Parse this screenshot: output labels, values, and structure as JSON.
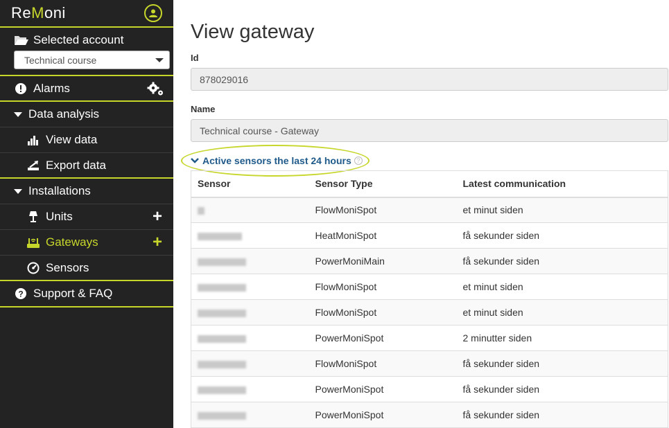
{
  "brand": {
    "logo_pre": "Re",
    "logo_m": "M",
    "logo_post": "oni",
    "accent": "#c7d62b"
  },
  "account": {
    "label": "Selected account",
    "selected": "Technical course"
  },
  "nav": {
    "alarms": "Alarms",
    "data_analysis": "Data analysis",
    "view_data": "View data",
    "export_data": "Export data",
    "installations": "Installations",
    "units": "Units",
    "gateways": "Gateways",
    "sensors": "Sensors",
    "support": "Support & FAQ",
    "plus": "+"
  },
  "main": {
    "title": "View gateway",
    "id_label": "Id",
    "id_value": "878029016",
    "name_label": "Name",
    "name_value": "Technical course - Gateway",
    "sensors_link": "Active sensors the last 24 hours",
    "help": "?"
  },
  "table": {
    "headers": [
      "Sensor",
      "Sensor Type",
      "Latest communication"
    ],
    "rows": [
      {
        "type": "FlowMoniSpot",
        "latest": "et minut siden"
      },
      {
        "type": "HeatMoniSpot",
        "latest": "få sekunder siden"
      },
      {
        "type": "PowerMoniMain",
        "latest": "få sekunder siden"
      },
      {
        "type": "FlowMoniSpot",
        "latest": "et minut siden"
      },
      {
        "type": "FlowMoniSpot",
        "latest": "et minut siden"
      },
      {
        "type": "PowerMoniSpot",
        "latest": "2 minutter siden"
      },
      {
        "type": "FlowMoniSpot",
        "latest": "få sekunder siden"
      },
      {
        "type": "PowerMoniSpot",
        "latest": "få sekunder siden"
      },
      {
        "type": "PowerMoniSpot",
        "latest": "få sekunder siden"
      }
    ]
  }
}
